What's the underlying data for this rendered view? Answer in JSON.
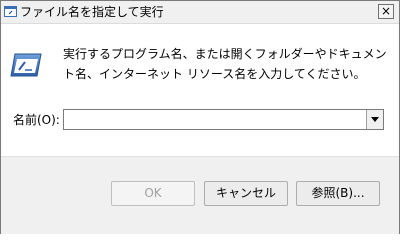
{
  "window": {
    "title": "ファイル名を指定して実行",
    "close_glyph": "×"
  },
  "dialog": {
    "description": "実行するプログラム名、または開くフォルダーやドキュメント名、インターネット リソース名を入力してください。",
    "name_label": "名前(O):",
    "name_value": ""
  },
  "buttons": {
    "ok": "OK",
    "cancel": "キャンセル",
    "browse": "参照(B)..."
  },
  "icons": {
    "title": "run-icon",
    "main": "run-window-icon",
    "dropdown": "chevron-down-icon",
    "close": "close-icon"
  },
  "colors": {
    "title_bg": "#f0f0f0",
    "footer_bg": "#f0f0f0",
    "icon_blue": "#3a6fb5"
  }
}
